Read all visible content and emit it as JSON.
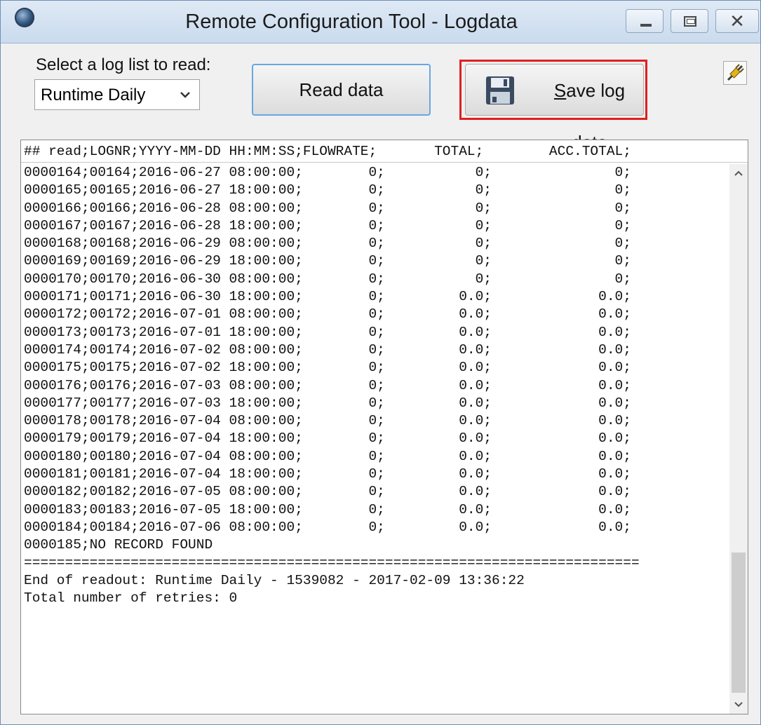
{
  "window": {
    "title": "Remote Configuration Tool - Logdata",
    "close_glyph": "✕"
  },
  "controls": {
    "select_label": "Select a log list to read:",
    "select_value": "Runtime Daily",
    "read_button": "Read data",
    "save_button_underlined": "S",
    "save_button_rest": "ave log data"
  },
  "icons": {
    "app": "app-icon",
    "save": "floppy-disk-icon",
    "connect": "plug-connector-icon",
    "dropdown": "chevron-down-icon"
  },
  "colors": {
    "highlight_border": "#e02020",
    "focused_button_border": "#67a7e3",
    "titlebar": "#c9dbee"
  },
  "log": {
    "header": "## read;LOGNR;YYYY-MM-DD HH:MM:SS;FLOWRATE;       TOTAL;        ACC.TOTAL;",
    "lines": [
      "0000164;00164;2016-06-27 08:00:00;        0;           0;               0;",
      "0000165;00165;2016-06-27 18:00:00;        0;           0;               0;",
      "0000166;00166;2016-06-28 08:00:00;        0;           0;               0;",
      "0000167;00167;2016-06-28 18:00:00;        0;           0;               0;",
      "0000168;00168;2016-06-29 08:00:00;        0;           0;               0;",
      "0000169;00169;2016-06-29 18:00:00;        0;           0;               0;",
      "0000170;00170;2016-06-30 08:00:00;        0;           0;               0;",
      "0000171;00171;2016-06-30 18:00:00;        0;         0.0;             0.0;",
      "0000172;00172;2016-07-01 08:00:00;        0;         0.0;             0.0;",
      "0000173;00173;2016-07-01 18:00:00;        0;         0.0;             0.0;",
      "0000174;00174;2016-07-02 08:00:00;        0;         0.0;             0.0;",
      "0000175;00175;2016-07-02 18:00:00;        0;         0.0;             0.0;",
      "0000176;00176;2016-07-03 08:00:00;        0;         0.0;             0.0;",
      "0000177;00177;2016-07-03 18:00:00;        0;         0.0;             0.0;",
      "0000178;00178;2016-07-04 08:00:00;        0;         0.0;             0.0;",
      "0000179;00179;2016-07-04 18:00:00;        0;         0.0;             0.0;",
      "0000180;00180;2016-07-04 08:00:00;        0;         0.0;             0.0;",
      "0000181;00181;2016-07-04 18:00:00;        0;         0.0;             0.0;",
      "0000182;00182;2016-07-05 08:00:00;        0;         0.0;             0.0;",
      "0000183;00183;2016-07-05 18:00:00;        0;         0.0;             0.0;",
      "0000184;00184;2016-07-06 08:00:00;        0;         0.0;             0.0;",
      "0000185;NO RECORD FOUND",
      "===========================================================================",
      "End of readout: Runtime Daily - 1539082 - 2017-02-09 13:36:22",
      "Total number of retries: 0"
    ]
  }
}
